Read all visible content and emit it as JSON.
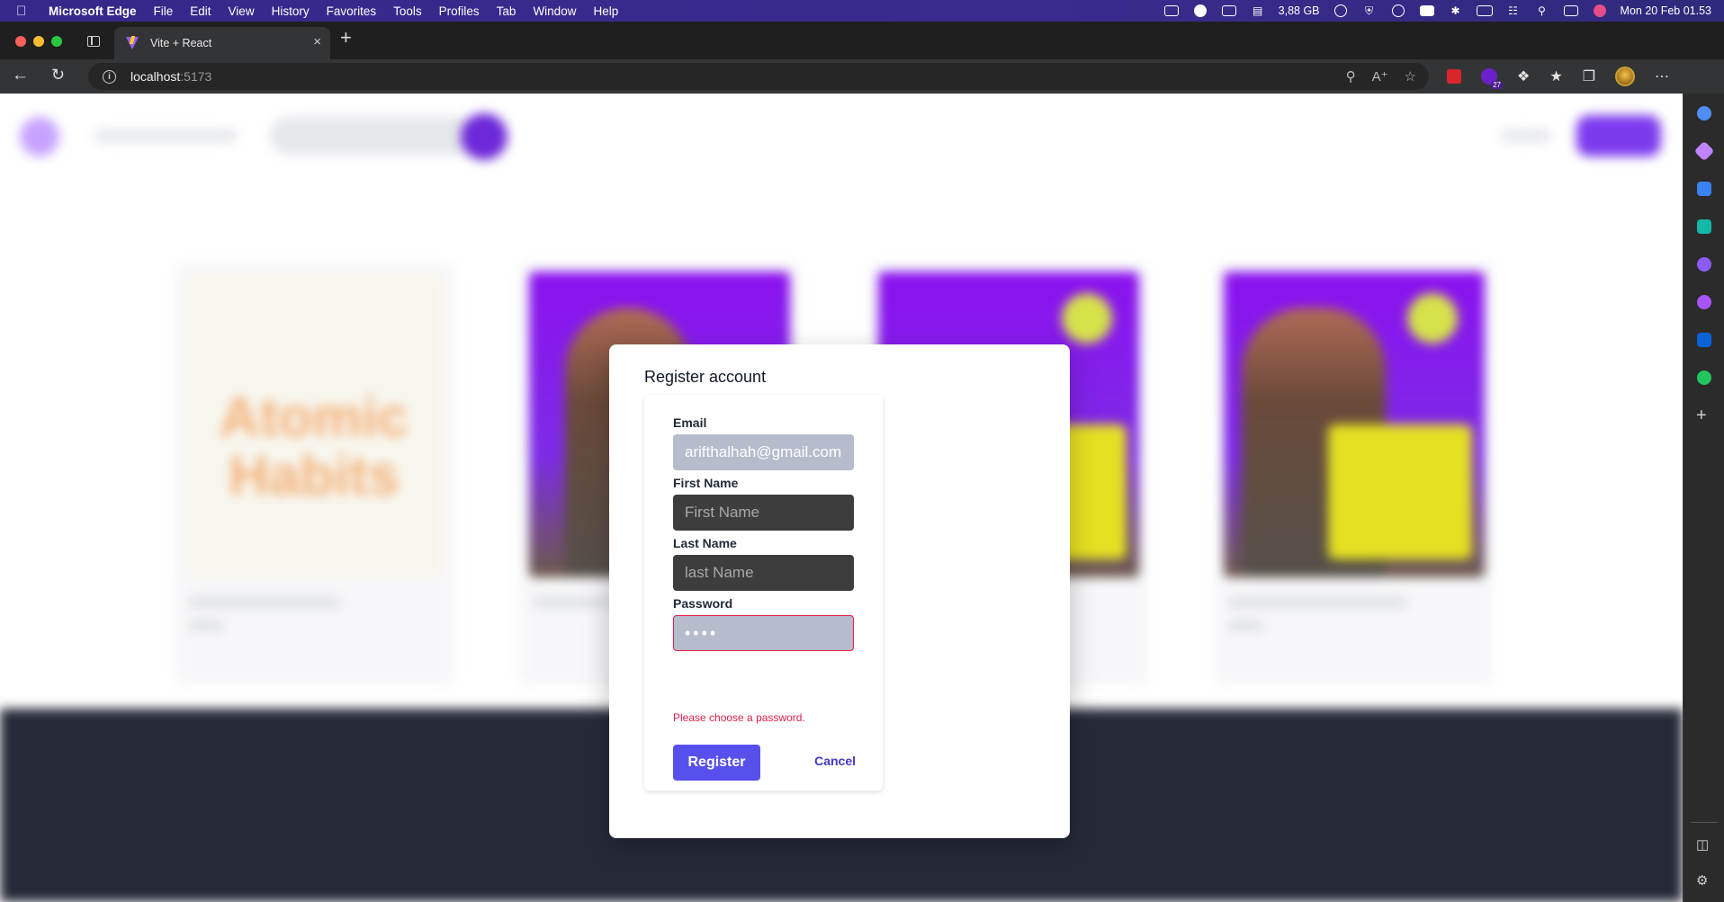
{
  "menubar": {
    "app_name": "Microsoft Edge",
    "items": [
      "File",
      "Edit",
      "View",
      "History",
      "Favorites",
      "Tools",
      "Profiles",
      "Tab",
      "Window",
      "Help"
    ],
    "memory": "3,88 GB",
    "datetime": "Mon 20 Feb  01.53"
  },
  "browser": {
    "tab_title": "Vite + React",
    "tab_close": "×",
    "new_tab": "+",
    "url_host": "localhost",
    "url_port": ":5173",
    "extension_badge": "27"
  },
  "background_page": {
    "book_title_text": "Atomic Habits"
  },
  "modal": {
    "title": "Register account",
    "email": {
      "label": "Email",
      "value": "arifthalhah@gmail.com"
    },
    "first_name": {
      "label": "First Name",
      "placeholder": "First Name"
    },
    "last_name": {
      "label": "Last Name",
      "placeholder": "last Name"
    },
    "password": {
      "label": "Password",
      "value": "••••",
      "error": "Please choose a password."
    },
    "register_label": "Register",
    "cancel_label": "Cancel"
  },
  "colors": {
    "accent": "#5850ec",
    "error": "#e11d48",
    "footer": "#262a38"
  }
}
